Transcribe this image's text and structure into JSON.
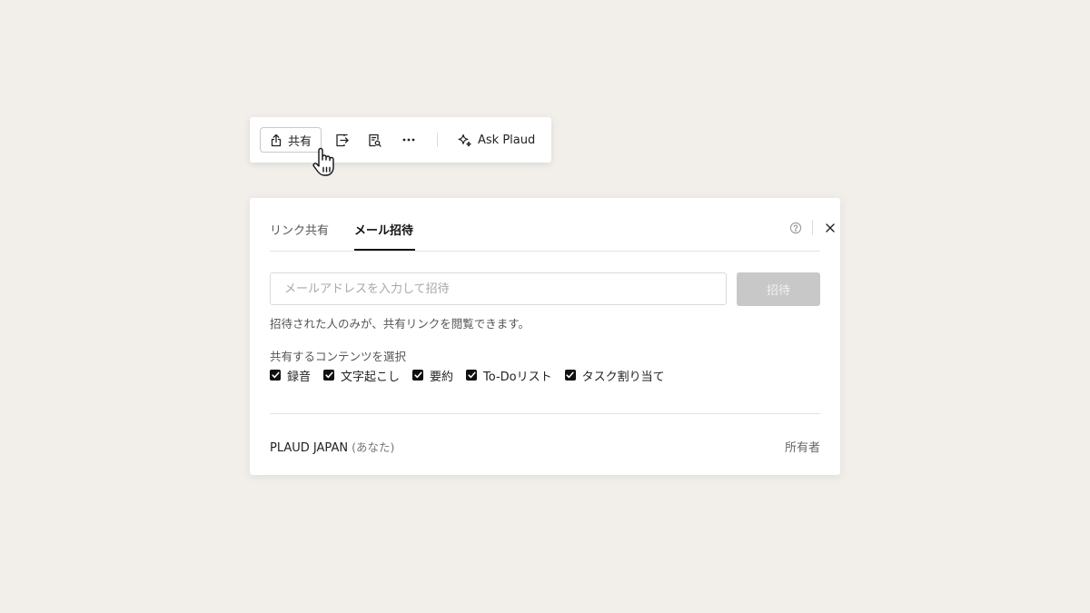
{
  "toolbar": {
    "share_label": "共有",
    "ask_label": "Ask Plaud",
    "icons": [
      "share-icon",
      "export-icon",
      "document-search-icon",
      "more-icon",
      "sparkle-icon"
    ]
  },
  "dialog": {
    "tabs": [
      {
        "label": "リンク共有",
        "active": false
      },
      {
        "label": "メール招待",
        "active": true
      }
    ],
    "email_placeholder": "メールアドレスを入力して招待",
    "email_value": "",
    "invite_label": "招待",
    "hint": "招待された人のみが、共有リンクを閲覧できます。",
    "content_label": "共有するコンテンツを選択",
    "options": [
      {
        "label": "録音",
        "checked": true
      },
      {
        "label": "文字起こし",
        "checked": true
      },
      {
        "label": "要約",
        "checked": true
      },
      {
        "label": "To-Doリスト",
        "checked": true
      },
      {
        "label": "タスク割り当て",
        "checked": true
      }
    ],
    "owner": {
      "name": "PLAUD JAPAN",
      "you": "(あなた)",
      "role": "所有者"
    }
  },
  "colors": {
    "background": "#f2efea",
    "invite_button_disabled": "#c8c8c8",
    "accent": "#111111"
  }
}
